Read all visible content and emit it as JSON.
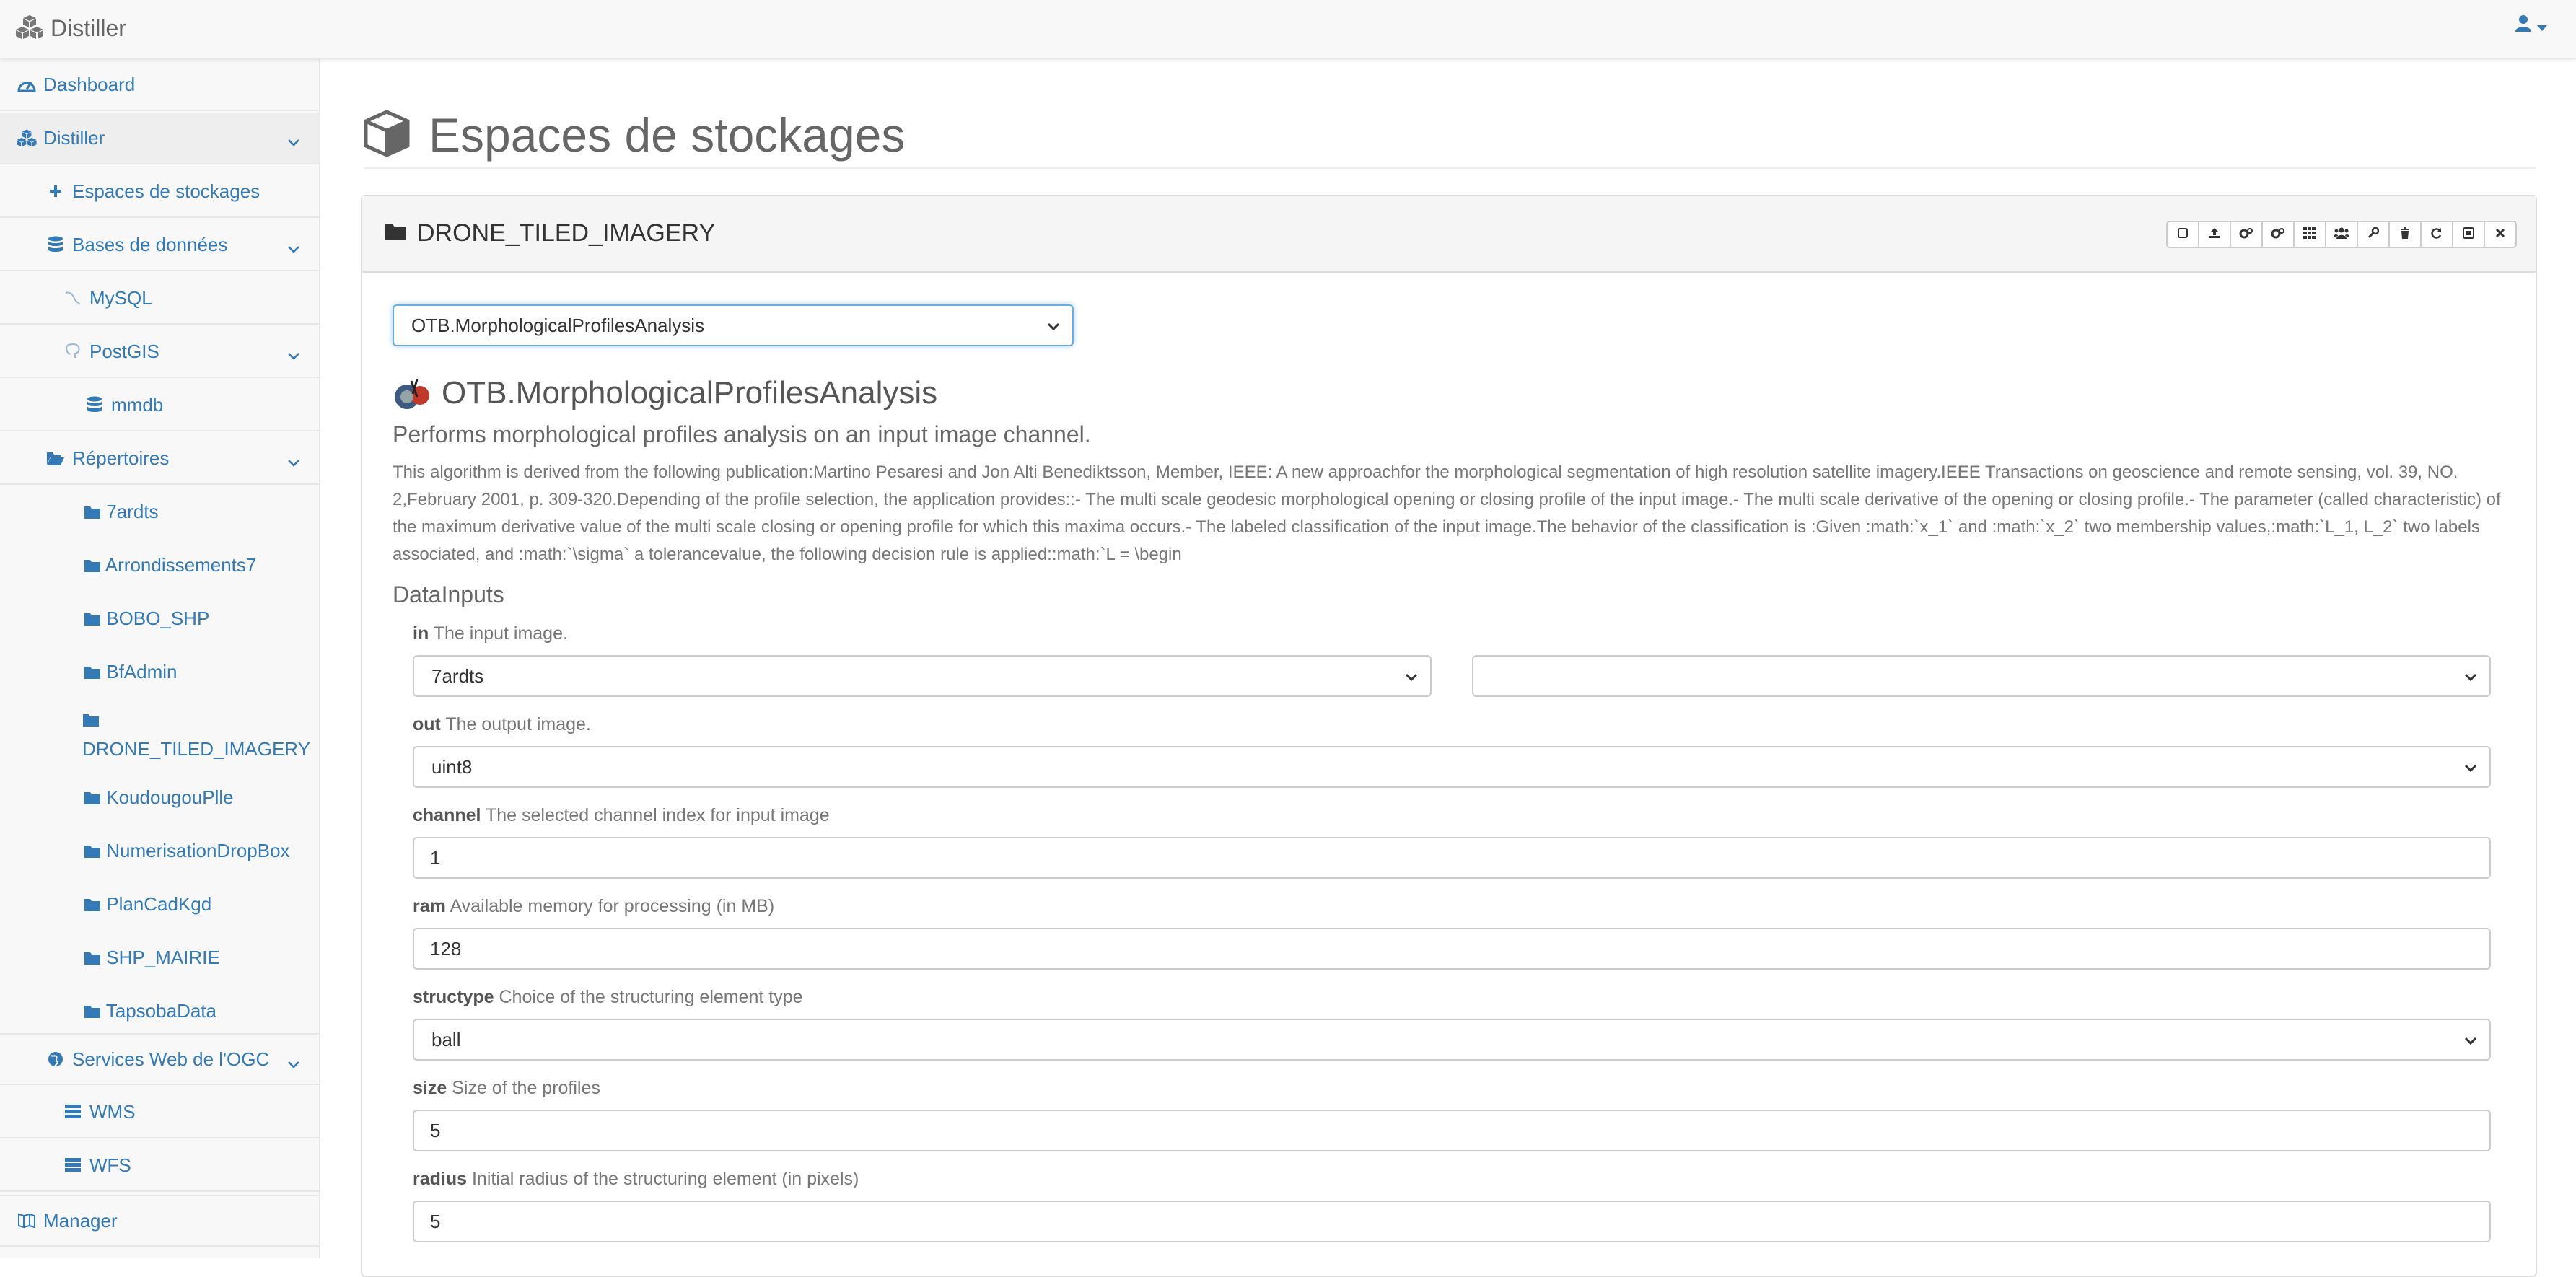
{
  "app": {
    "brand": "Distiller"
  },
  "navbar": {
    "user_icon": "user-icon"
  },
  "sidebar": {
    "dashboard": "Dashboard",
    "distiller": "Distiller",
    "espaces": "Espaces de stockages",
    "bases": "Bases de données",
    "mysql": "MySQL",
    "postgis": "PostGIS",
    "mmdb": "mmdb",
    "repertoires": "Répertoires",
    "folders": [
      "7ardts",
      "Arrondissements7",
      "BOBO_SHP",
      "BfAdmin",
      "DRONE_TILED_IMAGERY",
      "KoudougouPlle",
      "NumerisationDropBox",
      "PlanCadKgd",
      "SHP_MAIRIE",
      "TapsobaData"
    ],
    "ogc": "Services Web de l'OGC",
    "wms": "WMS",
    "wfs": "WFS",
    "manager": "Manager"
  },
  "page": {
    "title": "Espaces de stockages"
  },
  "panel": {
    "title": "DRONE_TILED_IMAGERY",
    "process_select": "OTB.MorphologicalProfilesAnalysis",
    "process_title": "OTB.MorphologicalProfilesAnalysis",
    "process_subtitle": "Performs morphological profiles analysis on an input image channel.",
    "abstract": "This algorithm is derived from the following publication:Martino Pesaresi and Jon Alti Benediktsson, Member, IEEE: A new approachfor the morphological segmentation of high resolution satellite imagery.IEEE Transactions on geoscience and remote sensing, vol. 39, NO. 2,February 2001, p. 309-320.Depending of the profile selection, the application provides::- The multi scale geodesic morphological opening or closing profile of the input image.- The multi scale derivative of the opening or closing profile.- The parameter (called characteristic) of the maximum derivative value of the multi scale closing or opening profile for which this maxima occurs.- The labeled classification of the input image.The behavior of the classification is :Given :math:`x_1` and :math:`x_2` two membership values,:math:`L_1, L_2` two labels associated, and :math:`\\sigma` a tolerancevalue, the following decision rule is applied::math:`L = \\begin",
    "datainputs_title": "DataInputs",
    "fields": {
      "in": {
        "name": "in",
        "desc": "The input image.",
        "value": "7ardts",
        "value2": ""
      },
      "out": {
        "name": "out",
        "desc": "The output image.",
        "value": "uint8"
      },
      "channel": {
        "name": "channel",
        "desc": "The selected channel index for input image",
        "value": "1"
      },
      "ram": {
        "name": "ram",
        "desc": "Available memory for processing (in MB)",
        "value": "128"
      },
      "structype": {
        "name": "structype",
        "desc": "Choice of the structuring element type",
        "value": "ball"
      },
      "size": {
        "name": "size",
        "desc": "Size of the profiles",
        "value": "5"
      },
      "radius": {
        "name": "radius",
        "desc": "Initial radius of the structuring element (in pixels)",
        "value": "5"
      }
    }
  },
  "colors": {
    "link": "#337ab7",
    "brand_text": "#666666",
    "sidebar_bg": "#f8f8f8"
  }
}
